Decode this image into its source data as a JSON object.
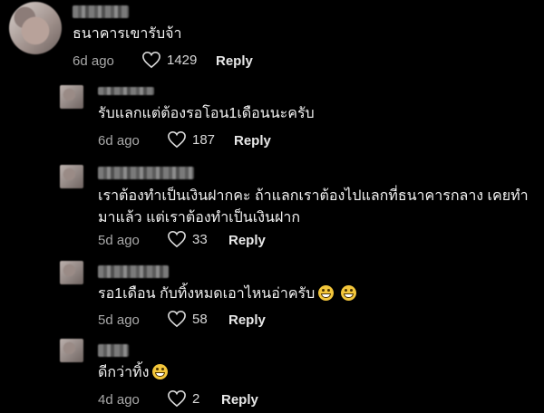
{
  "comments": [
    {
      "text": "ธนาคารเขารับจ้า",
      "time": "6d ago",
      "likes": "1429",
      "reply": "Reply"
    },
    {
      "text": "รับแลกแต่ต้องรอโอน1เดือนนะครับ",
      "time": "6d ago",
      "likes": "187",
      "reply": "Reply"
    },
    {
      "line1": "เราต้องทำเป็นเงินฝากคะ ถ้าแลกเราต้องไปแลกที่ธนาคารกลาง เคยทำ",
      "line2": "มาแล้ว แต่เราต้องทำเป็นเงินฝาก",
      "time": "5d ago",
      "likes": "33",
      "reply": "Reply"
    },
    {
      "text": "รอ1เดือน กับทิ้งหมดเอาไหนอ่าครับ",
      "time": "5d ago",
      "likes": "58",
      "reply": "Reply",
      "emoji": "grinning-face-icon"
    },
    {
      "text": "ดีกว่าทิ้ง",
      "time": "4d ago",
      "likes": "2",
      "reply": "Reply",
      "emoji": "grinning-face-icon"
    }
  ],
  "colors": {
    "background": "#000000",
    "meta": "#a8a8a8",
    "emoji": "#f3c63b"
  }
}
